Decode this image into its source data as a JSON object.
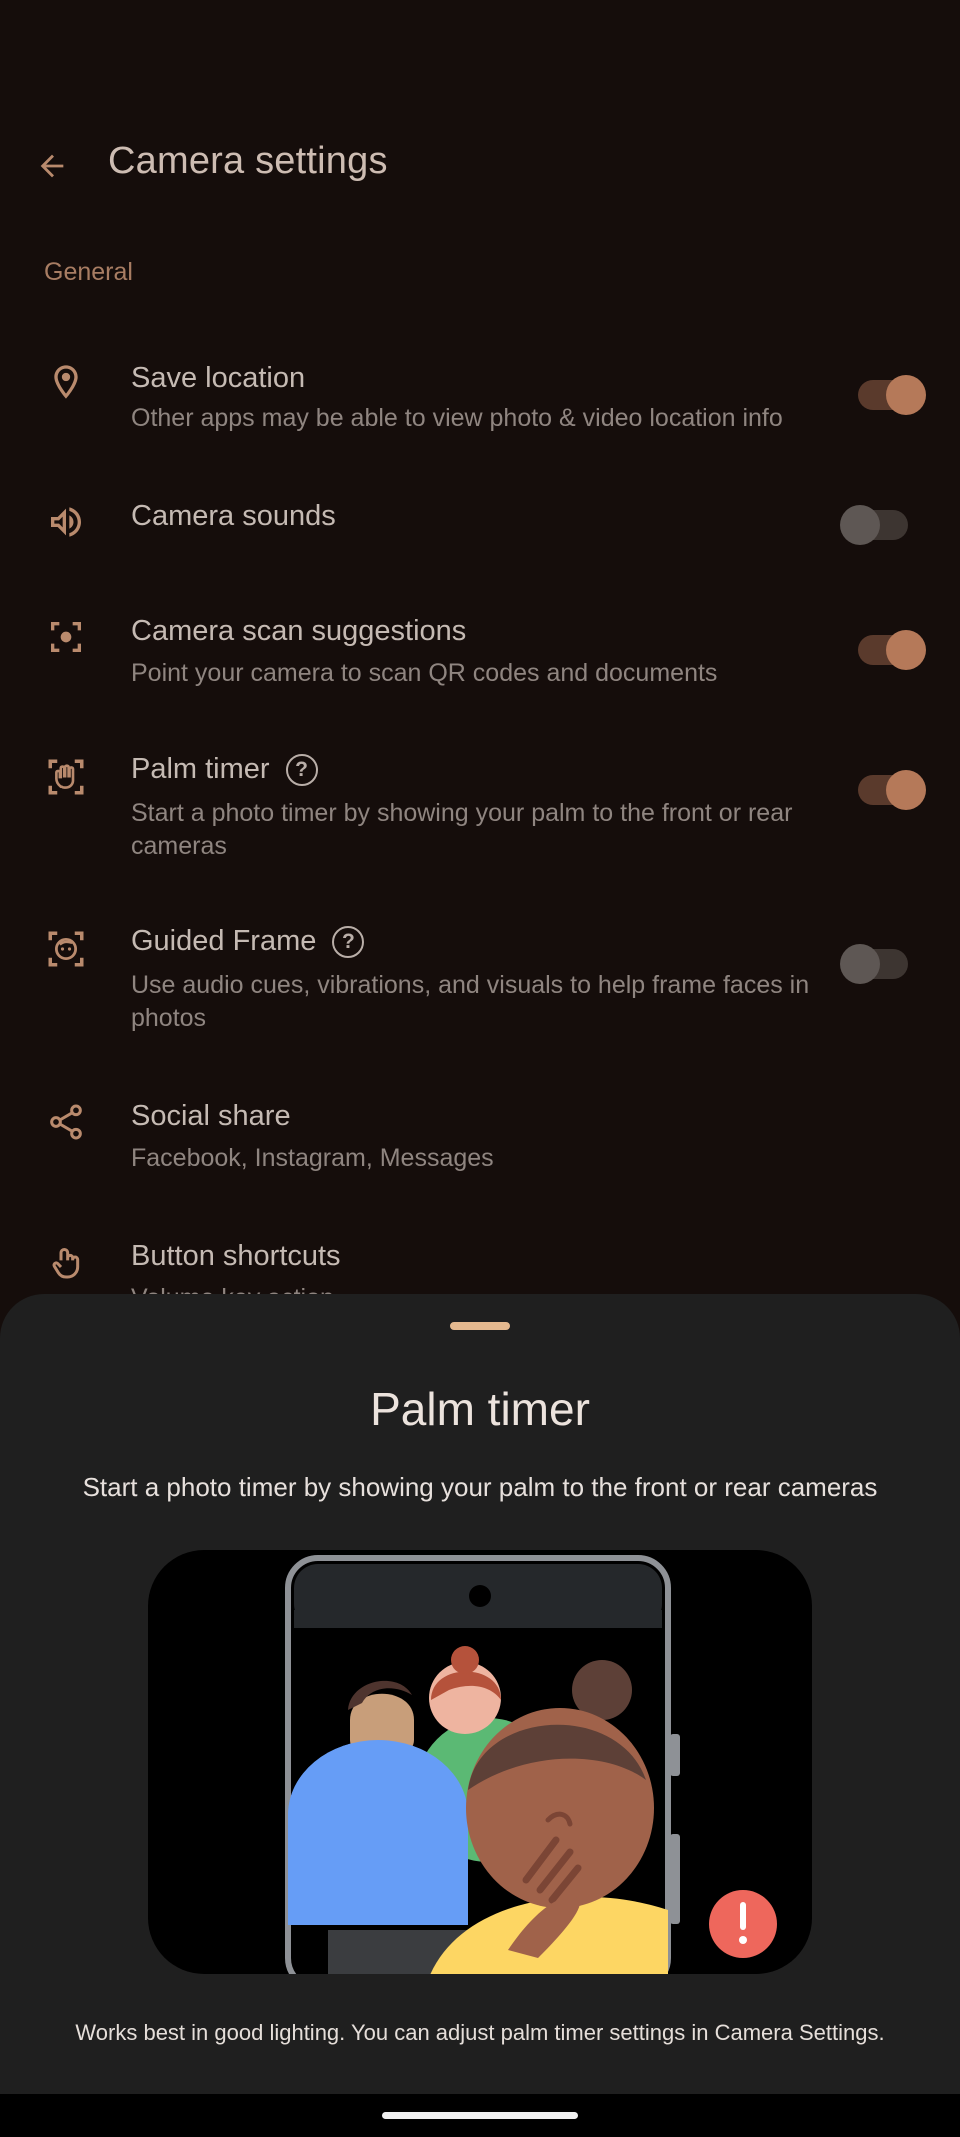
{
  "appbar": {
    "title": "Camera settings",
    "back_icon": "arrow-back-icon"
  },
  "section": {
    "general": "General"
  },
  "settings": [
    {
      "icon": "location-pin-icon",
      "title": "Save location",
      "subtitle": "Other apps may be able to view photo & video location info",
      "toggle": true
    },
    {
      "icon": "volume-icon",
      "title": "Camera sounds",
      "subtitle": "",
      "toggle": false
    },
    {
      "icon": "scan-icon",
      "title": "Camera scan suggestions",
      "subtitle": "Point your camera to scan QR codes and documents",
      "toggle": true
    },
    {
      "icon": "palm-icon",
      "title": "Palm timer",
      "subtitle": "Start a photo timer by showing your palm to the front or rear cameras",
      "toggle": true,
      "help": true
    },
    {
      "icon": "face-frame-icon",
      "title": "Guided Frame",
      "subtitle": "Use audio cues, vibrations, and visuals to help frame faces in photos",
      "toggle": false,
      "help": true
    },
    {
      "icon": "share-icon",
      "title": "Social share",
      "subtitle": "Facebook, Instagram, Messages"
    },
    {
      "icon": "touch-icon",
      "title": "Button shortcuts",
      "subtitle": "Volume key action"
    }
  ],
  "sheet": {
    "title": "Palm timer",
    "description": "Start a photo timer by showing your palm to the front or rear cameras",
    "note": "Works best in good lighting. You can adjust palm timer settings in Camera Settings."
  },
  "colors": {
    "accent": "#b57959",
    "background": "#150d0b",
    "sheet": "#1f1f1f"
  }
}
